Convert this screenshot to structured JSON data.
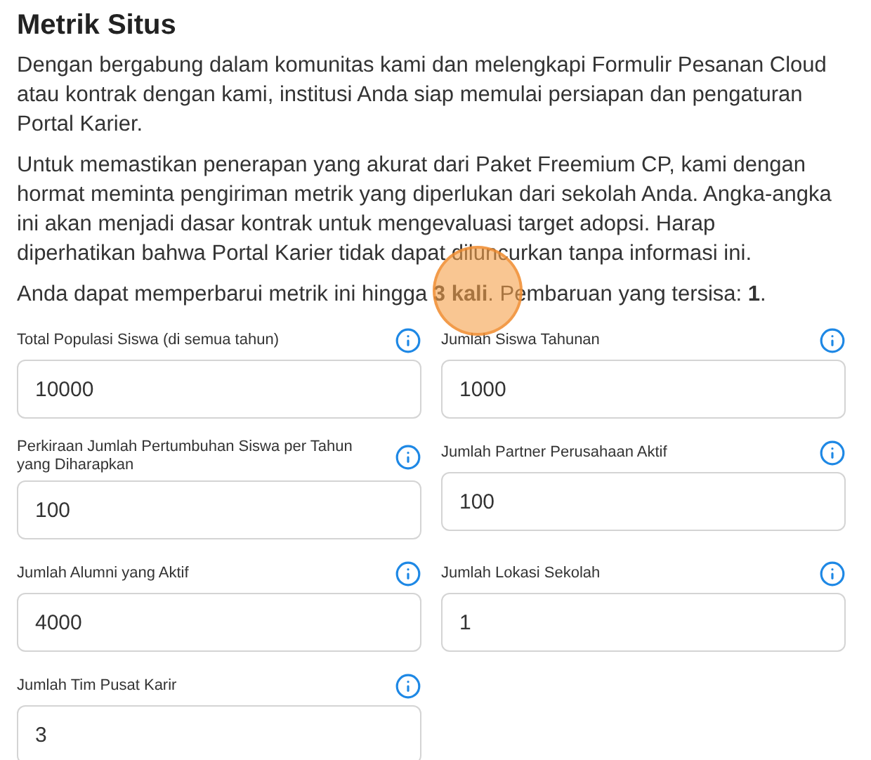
{
  "title": "Metrik Situs",
  "paragraphs": [
    "Dengan bergabung dalam komunitas kami dan melengkapi Formulir Pesanan Cloud atau kontrak dengan kami, institusi Anda siap memulai persiapan dan pengaturan Portal Karier.",
    "Untuk memastikan penerapan yang akurat dari Paket Freemium CP, kami dengan hormat meminta pengiriman metrik yang diperlukan dari sekolah Anda. Angka-angka ini akan menjadi dasar kontrak untuk mengevaluasi target adopsi. Harap diperhatikan bahwa Portal Karier tidak dapat diluncurkan tanpa informasi ini.",
    "Anda dapat memperbarui metrik ini hingga **3 kali**. Pembaruan yang tersisa: **1**."
  ],
  "fields": [
    {
      "label": "Total Populasi Siswa (di semua tahun)",
      "value": "10000"
    },
    {
      "label": "Jumlah Siswa Tahunan",
      "value": "1000"
    },
    {
      "label": "Perkiraan Jumlah Pertumbuhan Siswa per Tahun yang Diharapkan",
      "value": "100"
    },
    {
      "label": "Jumlah Partner Perusahaan Aktif",
      "value": "100"
    },
    {
      "label": "Jumlah Alumni yang Aktif",
      "value": "4000"
    },
    {
      "label": "Jumlah Lokasi Sekolah",
      "value": "1"
    },
    {
      "label": "Jumlah Tim Pusat Karir",
      "value": "3"
    }
  ]
}
